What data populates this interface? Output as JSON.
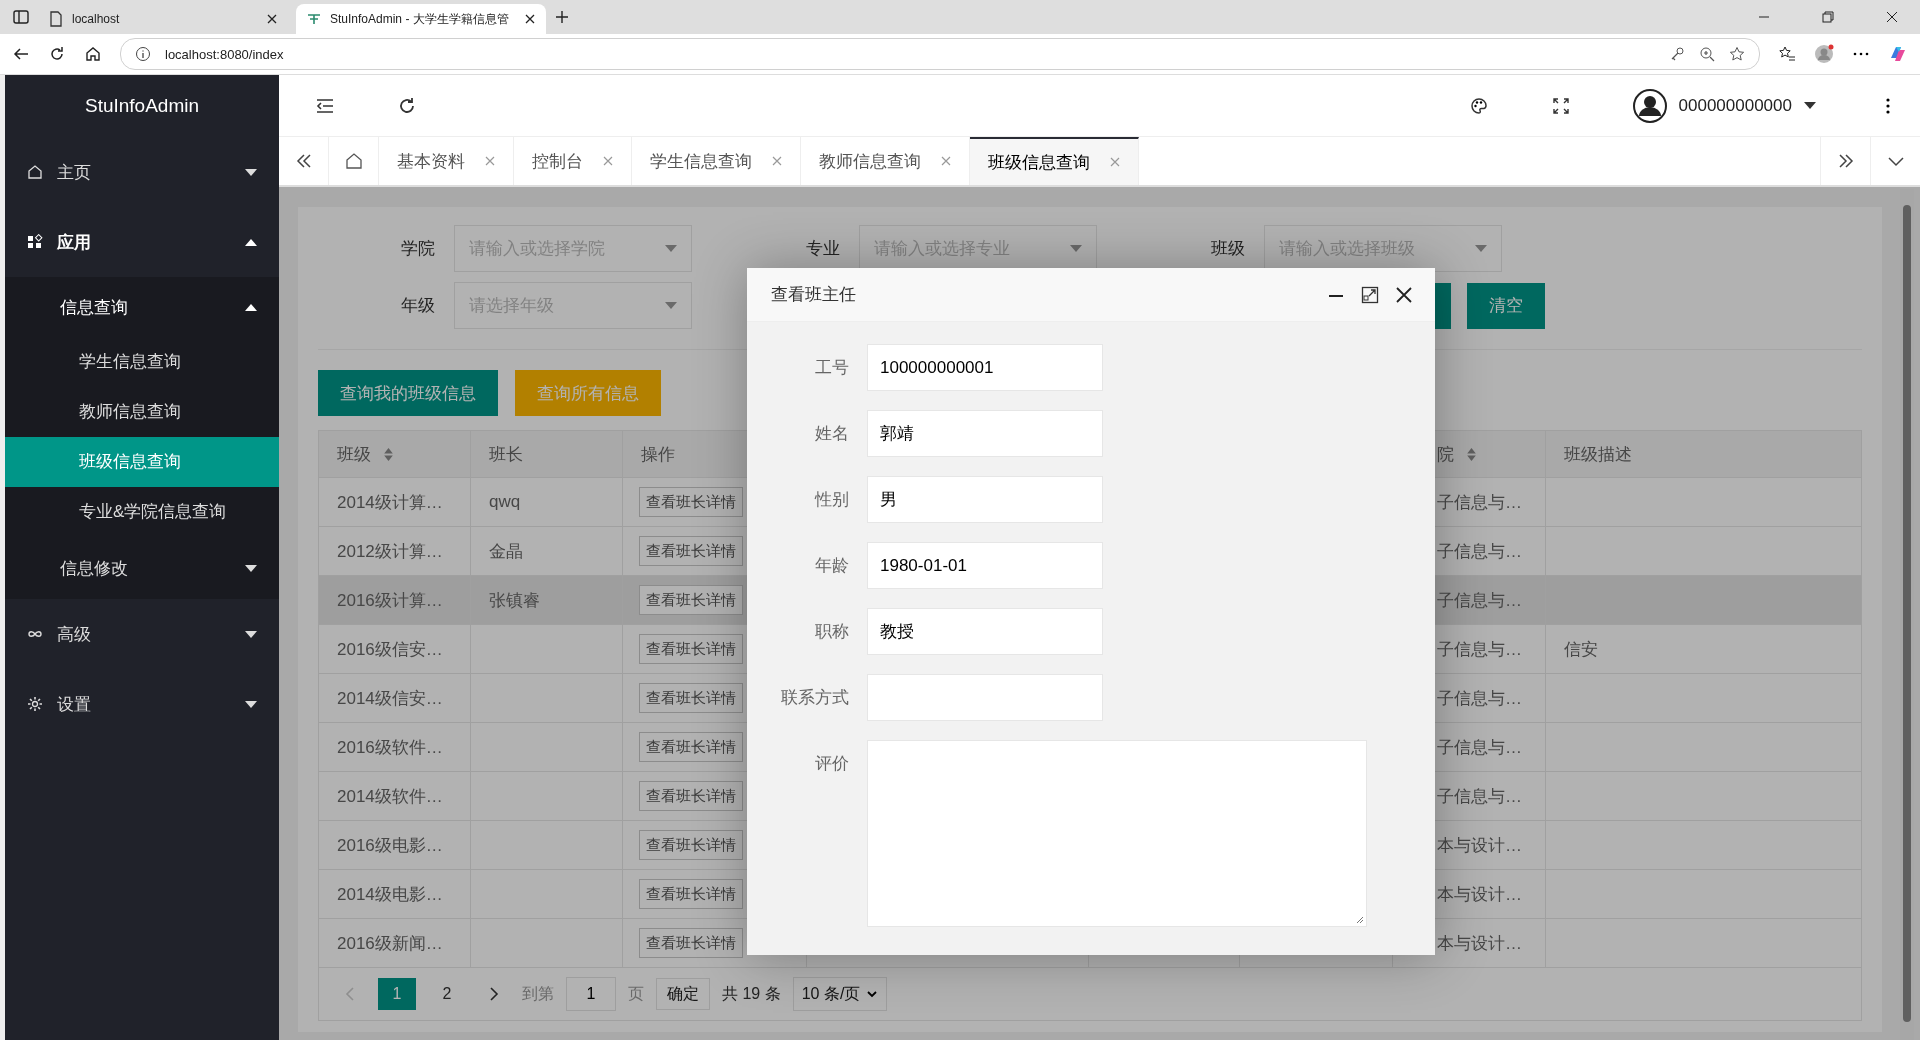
{
  "browser": {
    "tabs": [
      {
        "title": "localhost",
        "selected": false
      },
      {
        "title": "StuInfoAdmin - 大学生学籍信息管",
        "selected": true
      }
    ],
    "address": "localhost:8080/index"
  },
  "sidebar": {
    "logo": "StuInfoAdmin",
    "items": [
      {
        "label": "主页",
        "expanded": false
      },
      {
        "label": "应用",
        "expanded": true,
        "children": [
          {
            "label": "信息查询",
            "expanded": true,
            "children": [
              {
                "label": "学生信息查询",
                "selected": false
              },
              {
                "label": "教师信息查询",
                "selected": false
              },
              {
                "label": "班级信息查询",
                "selected": true
              },
              {
                "label": "专业&学院信息查询",
                "selected": false
              }
            ]
          },
          {
            "label": "信息修改",
            "expanded": false
          }
        ]
      },
      {
        "label": "高级",
        "expanded": false
      },
      {
        "label": "设置",
        "expanded": false
      }
    ]
  },
  "header": {
    "user": "000000000000"
  },
  "page_tabs": [
    {
      "label": "基本资料",
      "selected": false
    },
    {
      "label": "控制台",
      "selected": false
    },
    {
      "label": "学生信息查询",
      "selected": false
    },
    {
      "label": "教师信息查询",
      "selected": false
    },
    {
      "label": "班级信息查询",
      "selected": true
    }
  ],
  "filters": [
    {
      "label": "学院",
      "placeholder": "请输入或选择学院"
    },
    {
      "label": "专业",
      "placeholder": "请输入或选择专业"
    },
    {
      "label": "班级",
      "placeholder": "请输入或选择班级"
    },
    {
      "label": "年级",
      "placeholder": "请选择年级"
    }
  ],
  "reset_button": "清空",
  "actions": [
    {
      "label": "查询我的班级信息",
      "kind": "primary"
    },
    {
      "label": "查询所有信息",
      "kind": "warning"
    }
  ],
  "table": {
    "columns": [
      {
        "label": "班级",
        "sortable": true
      },
      {
        "label": "班长",
        "sortable": false
      },
      {
        "label": "操作",
        "sortable": false
      },
      {
        "label": "院",
        "sortable": true
      },
      {
        "label": "班级描述",
        "sortable": false
      }
    ],
    "rows": [
      {
        "class": "2014级计算…",
        "monitor": "qwq",
        "action": "查看班长详情",
        "college": "子信息与…",
        "hovered": false
      },
      {
        "class": "2012级计算…",
        "monitor": "金晶",
        "action": "查看班长详情",
        "college": "子信息与…",
        "hovered": false
      },
      {
        "class": "2016级计算…",
        "monitor": "张镇睿",
        "action": "查看班长详情",
        "college": "子信息与…",
        "hovered": true
      },
      {
        "class": "2016级信安…",
        "action": "查看班长详情",
        "college": "子信息与…",
        "description": "信安",
        "hovered": false
      },
      {
        "class": "2014级信安…",
        "action": "查看班长详情",
        "college": "子信息与…",
        "hovered": false
      },
      {
        "class": "2016级软件…",
        "action": "查看班长详情",
        "college": "子信息与…",
        "hovered": false
      },
      {
        "class": "2014级软件…",
        "action": "查看班长详情",
        "college": "子信息与…",
        "hovered": false
      },
      {
        "class": "2016级电影…",
        "action": "查看班长详情",
        "college": "本与设计…",
        "hovered": false
      },
      {
        "class": "2014级电影…",
        "action": "查看班长详情",
        "college": "本与设计…",
        "hovered": false
      },
      {
        "class": "2016级新闻…",
        "action": "查看班长详情",
        "college": "本与设计…",
        "hovered": false
      }
    ]
  },
  "pagination": {
    "prev_disabled": true,
    "pages": [
      {
        "label": "1",
        "selected": true
      },
      {
        "label": "2",
        "selected": false
      }
    ],
    "goto_label": "到第",
    "goto_value": "1",
    "page_label": "页",
    "confirm": "确定",
    "total": "共 19 条",
    "page_size": "10 条/页"
  },
  "dialog": {
    "title": "查看班主任",
    "fields": [
      {
        "label": "工号",
        "value": "100000000001",
        "kind": "input"
      },
      {
        "label": "姓名",
        "value": "郭靖",
        "kind": "input"
      },
      {
        "label": "性别",
        "value": "男",
        "kind": "input"
      },
      {
        "label": "年龄",
        "value": "1980-01-01",
        "kind": "input"
      },
      {
        "label": "职称",
        "value": "教授",
        "kind": "input"
      },
      {
        "label": "联系方式",
        "kind": "input"
      },
      {
        "label": "评价",
        "kind": "textarea"
      }
    ]
  }
}
